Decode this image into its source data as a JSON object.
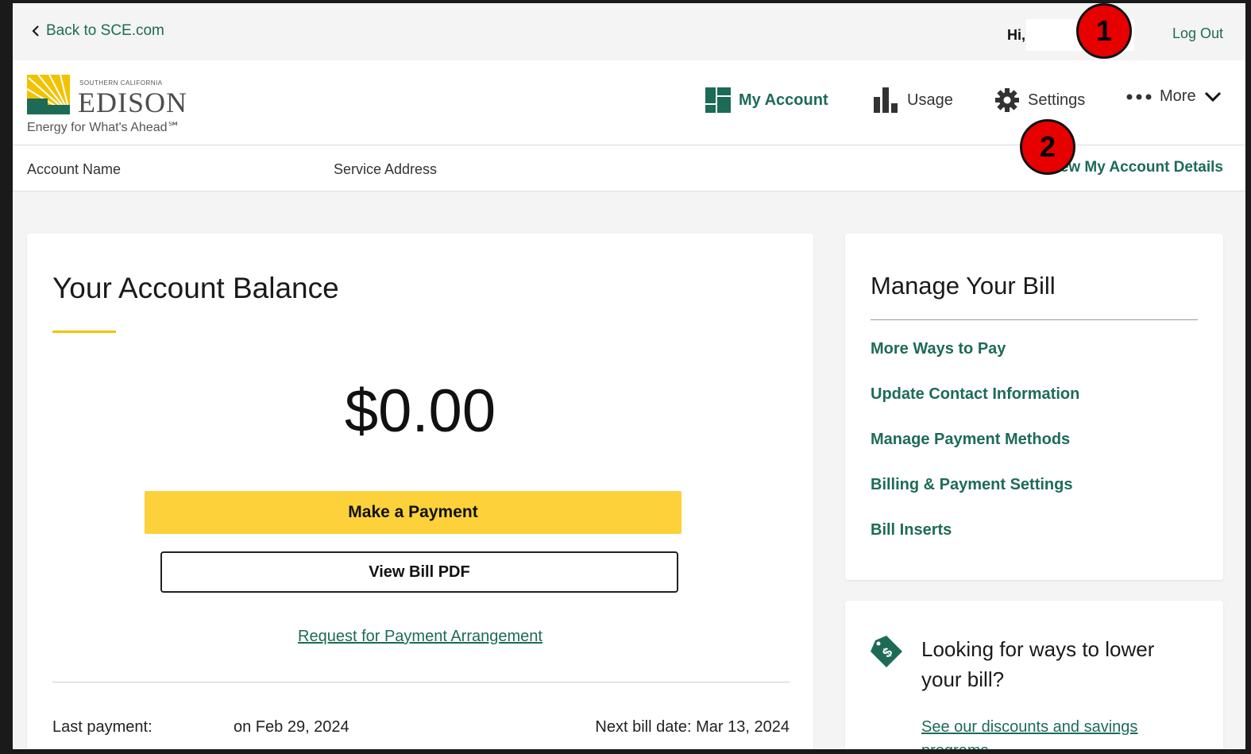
{
  "utility_bar": {
    "back_link": "Back to SCE.com",
    "greeting": "Hi,",
    "logout": "Log Out"
  },
  "logo": {
    "small_text": "SOUTHERN CALIFORNIA",
    "brand": "EDISON",
    "tagline": "Energy for What's Ahead℠"
  },
  "nav": {
    "items": [
      {
        "label": "My Account",
        "icon": "dashboard-icon"
      },
      {
        "label": "Usage",
        "icon": "bar-chart-icon"
      },
      {
        "label": "Settings",
        "icon": "gear-icon"
      },
      {
        "label": "More",
        "icon": "more-dots-icon"
      }
    ]
  },
  "account_row": {
    "account_name_label": "Account Name",
    "service_address_label": "Service Address",
    "details_link": "View My Account Details"
  },
  "balance": {
    "title": "Your Account Balance",
    "amount": "$0.00",
    "pay_button": "Make a Payment",
    "pdf_button": "View Bill PDF",
    "arrangement_link": "Request for Payment Arrangement",
    "last_payment_label": "Last payment:",
    "last_payment_date": "on Feb 29, 2024",
    "next_bill": "Next bill date: Mar 13, 2024"
  },
  "manage": {
    "title": "Manage Your Bill",
    "links": [
      "More Ways to Pay",
      "Update Contact Information",
      "Manage Payment Methods",
      "Billing & Payment Settings",
      "Bill Inserts"
    ]
  },
  "savings": {
    "heading": "Looking for ways to lower your bill?",
    "link": "See our discounts and savings programs"
  },
  "annotations": {
    "marker_1": "1",
    "marker_2": "2"
  },
  "colors": {
    "brand_green": "#1d6b56",
    "brand_yellow": "#fdd13a",
    "marker_red": "#e60000"
  }
}
